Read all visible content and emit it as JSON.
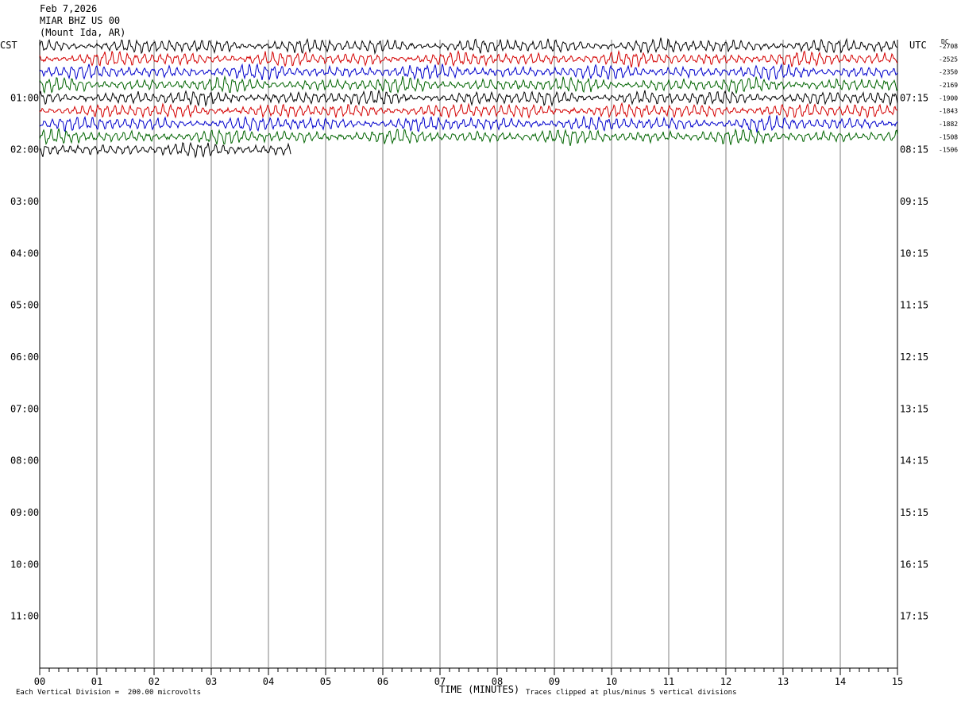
{
  "header": {
    "date": "Feb 7,2026",
    "station": "MIAR BHZ US 00",
    "location": "(Mount Ida, AR)"
  },
  "labels": {
    "left_tz": "CST",
    "right_tz": "UTC",
    "dc": "DC",
    "xlabel": "TIME (MINUTES)",
    "footer_left": "Each Vertical Division =  200.00 microvolts",
    "footer_right": "Traces clipped at plus/minus 5 vertical divisions"
  },
  "colors": {
    "trace_cycle": [
      "#000000",
      "#d40000",
      "#0000cc",
      "#006400"
    ],
    "grid": "#808080"
  },
  "chart_data": {
    "type": "line",
    "title": "MIAR BHZ US 00",
    "xlabel": "TIME (MINUTES)",
    "x_ticks": [
      "00",
      "01",
      "02",
      "03",
      "04",
      "05",
      "06",
      "07",
      "08",
      "09",
      "10",
      "11",
      "12",
      "13",
      "14",
      "15"
    ],
    "xlim": [
      0,
      15
    ],
    "left_hour_labels": [
      "01:00",
      "02:00",
      "03:00",
      "04:00",
      "05:00",
      "06:00",
      "07:00",
      "08:00",
      "09:00",
      "10:00",
      "11:00"
    ],
    "right_hour_labels": [
      "07:15",
      "08:15",
      "09:15",
      "10:15",
      "11:15",
      "12:15",
      "13:15",
      "14:15",
      "15:15",
      "16:15",
      "17:15"
    ],
    "traces_per_hour": 4,
    "rows_visible": 48,
    "dc_offsets": [
      "-2708",
      "-2525",
      "-2350",
      "-2169",
      "-1900",
      "-1843",
      "-1882",
      "-1508",
      "-1506"
    ],
    "traces": [
      {
        "row": 0,
        "color_index": 0,
        "end_minute": 15
      },
      {
        "row": 1,
        "color_index": 1,
        "end_minute": 15
      },
      {
        "row": 2,
        "color_index": 2,
        "end_minute": 15
      },
      {
        "row": 3,
        "color_index": 3,
        "end_minute": 15
      },
      {
        "row": 4,
        "color_index": 0,
        "end_minute": 15
      },
      {
        "row": 5,
        "color_index": 1,
        "end_minute": 15
      },
      {
        "row": 6,
        "color_index": 2,
        "end_minute": 15
      },
      {
        "row": 7,
        "color_index": 3,
        "end_minute": 15
      },
      {
        "row": 8,
        "color_index": 0,
        "end_minute": 4.4
      }
    ]
  }
}
